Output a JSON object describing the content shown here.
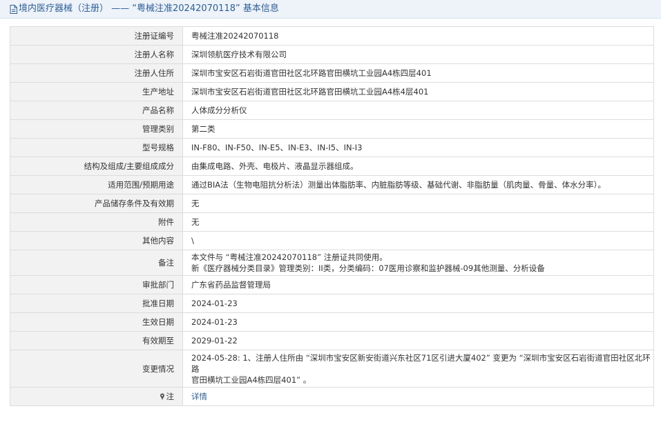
{
  "header": {
    "title": "境内医疗器械（注册） —— “粤械注准20242070118” 基本信息"
  },
  "rows": [
    {
      "label": "注册证编号",
      "value": "粤械注准20242070118"
    },
    {
      "label": "注册人名称",
      "value": "深圳领航医疗技术有限公司"
    },
    {
      "label": "注册人住所",
      "value": "深圳市宝安区石岩街道官田社区北环路官田横坑工业园A4栋四层401"
    },
    {
      "label": "生产地址",
      "value": "深圳市宝安区石岩街道官田社区北环路官田横坑工业园A4栋4层401"
    },
    {
      "label": "产品名称",
      "value": "人体成分分析仪"
    },
    {
      "label": "管理类别",
      "value": "第二类"
    },
    {
      "label": "型号规格",
      "value": "IN-F80、IN-F50、IN-E5、IN-E3、IN-I5、IN-I3"
    },
    {
      "label": "结构及组成/主要组成成分",
      "value": "由集成电路、外壳、电极片、液晶显示器组成。"
    },
    {
      "label": "适用范围/预期用途",
      "value": "通过BIA法（生物电阻抗分析法）测量出体脂肪率、内脏脂肪等级、基础代谢、非脂肪量（肌肉量、骨量、体水分率）。"
    },
    {
      "label": "产品储存条件及有效期",
      "value": "无"
    },
    {
      "label": "附件",
      "value": "无"
    },
    {
      "label": "其他内容",
      "value": "\\"
    }
  ],
  "remark": {
    "label": "备注",
    "line1": "本文件与 “粤械注准20242070118” 注册证共同使用。",
    "line2": "新《医疗器械分类目录》管理类别：II类，分类编码：07医用诊察和监护器械-09其他测量、分析设备"
  },
  "rows2": [
    {
      "label": "审批部门",
      "value": "广东省药品监督管理局"
    },
    {
      "label": "批准日期",
      "value": "2024-01-23"
    },
    {
      "label": "生效日期",
      "value": "2024-01-23"
    },
    {
      "label": "有效期至",
      "value": "2029-01-22"
    }
  ],
  "change": {
    "label": "变更情况",
    "line1": "2024-05-28: 1、注册人住所由 “深圳市宝安区新安街道兴东社区71区引进大厦402” 变更为 “深圳市宝安区石岩街道官田社区北环路",
    "line2": "官田横坑工业园A4栋四层401” 。"
  },
  "note": {
    "label": "注",
    "link": "详情"
  },
  "colors": {
    "accent": "#2c5e96",
    "label_bg": "#f2f2f2",
    "border": "#dcdcdc"
  },
  "icons": {
    "title": "document-icon",
    "note": "pin-icon"
  }
}
